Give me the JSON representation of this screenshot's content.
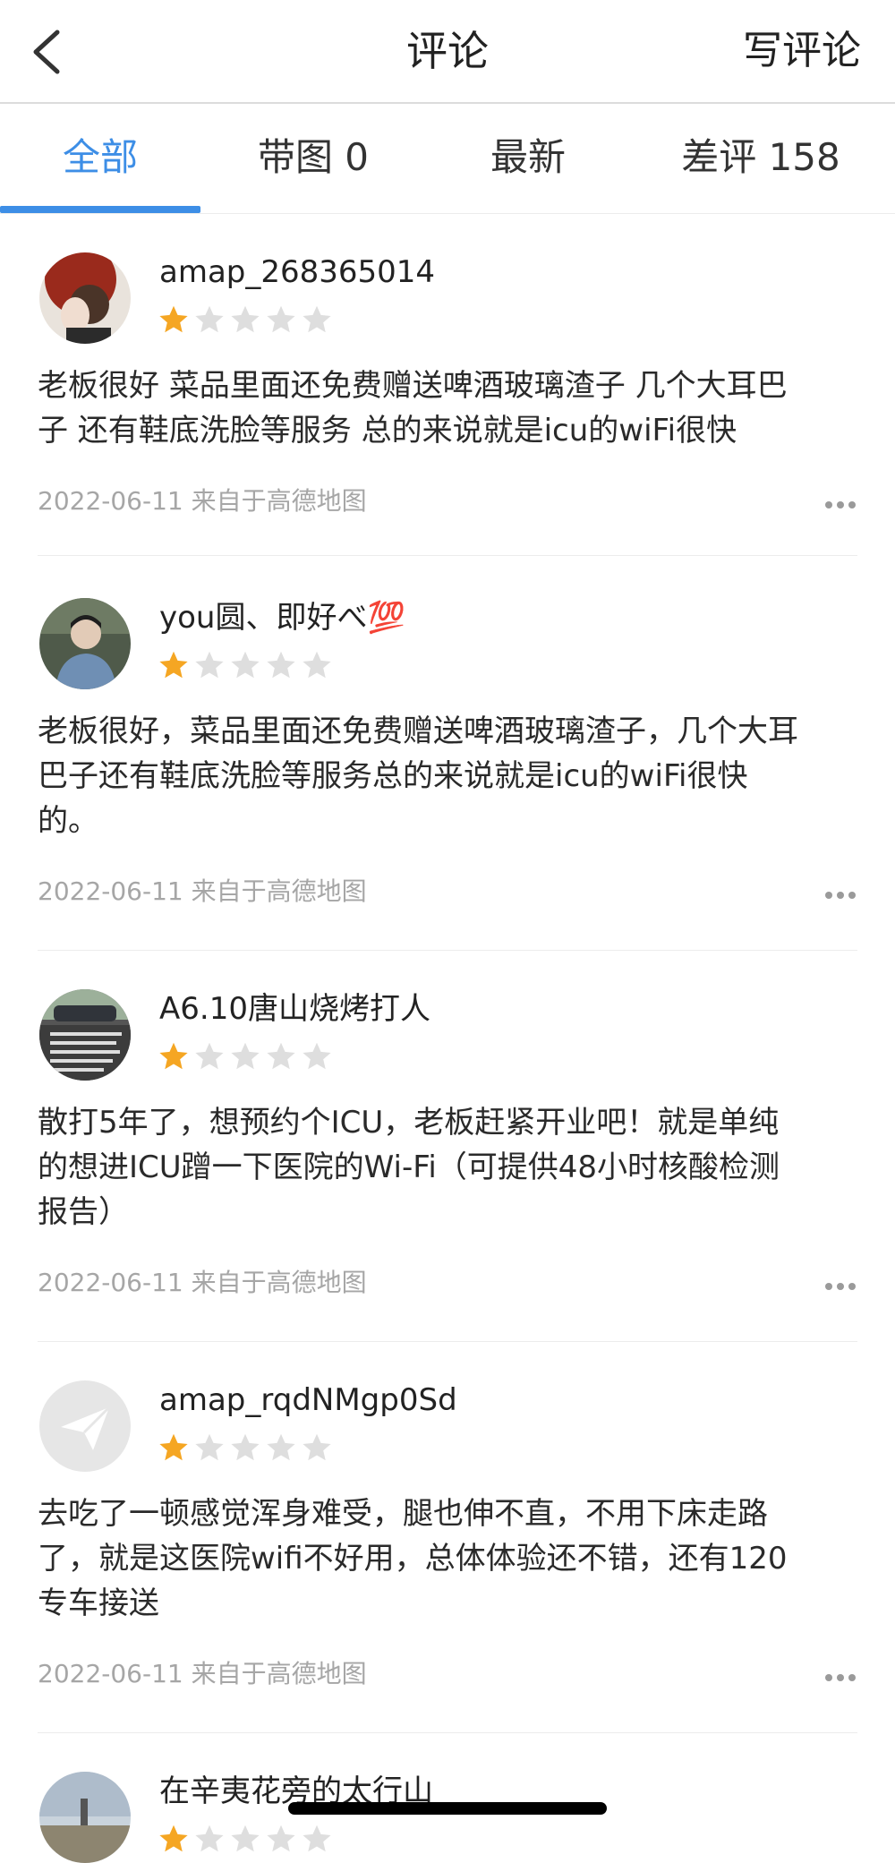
{
  "header": {
    "title": "评论",
    "write_label": "写评论"
  },
  "tabs": [
    {
      "label": "全部",
      "active": true
    },
    {
      "label": "带图 0",
      "active": false
    },
    {
      "label": "最新",
      "active": false
    },
    {
      "label": "差评 158",
      "active": false
    }
  ],
  "colors": {
    "accent": "#3d8ee6",
    "star_filled": "#f5a623",
    "star_empty": "#dedede"
  },
  "reviews": [
    {
      "username": "amap_268365014",
      "rating": 1,
      "lines": [
        "老板很好 菜品里面还免费赠送啤酒玻璃渣子 几个大耳巴",
        "子 还有鞋底洗脸等服务 总的来说就是icu的wiFi很快"
      ],
      "meta": "2022-06-11 来自于高德地图"
    },
    {
      "username": "you圆、即好べ💯",
      "rating": 1,
      "lines": [
        "老板很好，菜品里面还免费赠送啤酒玻璃渣子，几个大耳",
        "巴子还有鞋底洗脸等服务总的来说就是icu的wiFi很快",
        "的。"
      ],
      "meta": "2022-06-11 来自于高德地图"
    },
    {
      "username": "A6.10唐山烧烤打人",
      "rating": 1,
      "lines": [
        "散打5年了，想预约个ICU，老板赶紧开业吧！就是单纯",
        "的想进ICU蹭一下医院的Wi-Fi（可提供48小时核酸检测",
        "报告）"
      ],
      "meta": "2022-06-11 来自于高德地图"
    },
    {
      "username": "amap_rqdNMgp0Sd",
      "rating": 1,
      "lines": [
        "去吃了一顿感觉浑身难受，腿也伸不直，不用下床走路",
        "了，就是这医院wifi不好用，总体体验还不错，还有120",
        "专车接送"
      ],
      "meta": "2022-06-11 来自于高德地图"
    },
    {
      "username": "在辛夷花旁的太行山",
      "rating": 1,
      "lines": [],
      "meta": ""
    }
  ]
}
